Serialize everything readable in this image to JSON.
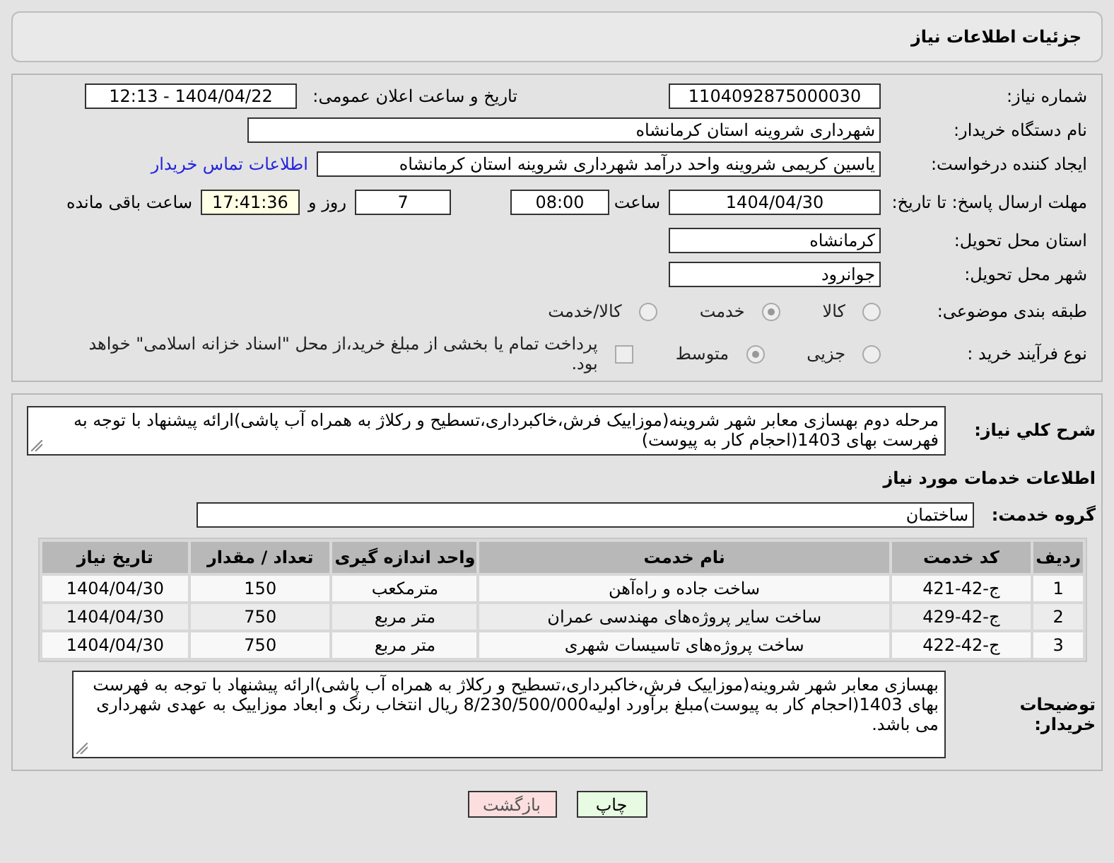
{
  "page_title": "جزئیات اطلاعات نیاز",
  "need_info": {
    "need_number": {
      "label": "شماره نیاز:",
      "value": "1104092875000030"
    },
    "announce_datetime": {
      "label": "تاریخ و ساعت اعلان عمومی:",
      "value": "1404/04/22 - 12:13"
    },
    "buyer_org": {
      "label": "نام دستگاه خریدار:",
      "value": "شهرداری شروینه استان کرمانشاه"
    },
    "requester": {
      "label": "ایجاد کننده درخواست:",
      "value": "یاسین کریمی شروینه واحد درآمد شهرداری شروینه استان کرمانشاه",
      "link": "اطلاعات تماس خریدار"
    },
    "deadline": {
      "label": "مهلت ارسال پاسخ: تا تاریخ:",
      "date": "1404/04/30",
      "time_label": "ساعت",
      "time": "08:00",
      "days": "7",
      "days_label": "روز و",
      "remaining": "17:41:36",
      "remaining_label": "ساعت باقی مانده"
    },
    "province": {
      "label": "استان محل تحویل:",
      "value": "کرمانشاه"
    },
    "city": {
      "label": "شهر محل تحویل:",
      "value": "جوانرود"
    },
    "category": {
      "label": "طبقه بندی موضوعی:",
      "options": [
        {
          "label": "کالا",
          "selected": false
        },
        {
          "label": "خدمت",
          "selected": true
        },
        {
          "label": "کالا/خدمت",
          "selected": false
        }
      ]
    },
    "process": {
      "label": "نوع فرآیند خرید :",
      "options": [
        {
          "label": "جزیی",
          "selected": false
        },
        {
          "label": "متوسط",
          "selected": true
        }
      ],
      "payment_note": {
        "label": "پرداخت تمام یا بخشی از مبلغ خرید،از محل \"اسناد خزانه اسلامی\" خواهد بود.",
        "checked": false
      }
    }
  },
  "services": {
    "summary": {
      "label": "شرح کلي نياز:",
      "value": "مرحله دوم بهسازی معابر شهر شروینه(موزاییک فرش،خاکبرداری،تسطیح و رکلاژ به همراه آب پاشی)ارائه پیشنهاد با توجه به فهرست بهای 1403(احجام کار به پیوست)"
    },
    "heading": "اطلاعات خدمات مورد نیاز",
    "service_group": {
      "label": "گروه خدمت:",
      "value": "ساختمان"
    },
    "table": {
      "columns": [
        "ردیف",
        "کد خدمت",
        "نام خدمت",
        "واحد اندازه گیری",
        "تعداد / مقدار",
        "تاریخ نیاز"
      ],
      "rows": [
        [
          "1",
          "ج-42-421",
          "ساخت جاده و راه‌آهن",
          "مترمکعب",
          "150",
          "1404/04/30"
        ],
        [
          "2",
          "ج-42-429",
          "ساخت سایر پروژه‌های مهندسی عمران",
          "متر مربع",
          "750",
          "1404/04/30"
        ],
        [
          "3",
          "ج-42-422",
          "ساخت پروژه‌های تاسیسات شهری",
          "متر مربع",
          "750",
          "1404/04/30"
        ]
      ]
    },
    "buyer_notes": {
      "label": "توضیحات خریدار:",
      "value": "بهسازی معابر شهر شروینه(موزاییک فرش،خاکبرداری،تسطیح و رکلاژ به همراه آب پاشی)ارائه پیشنهاد با توجه به فهرست بهای 1403(احجام کار به پیوست)مبلغ برآورد اولیه8/230/500/000 ریال انتخاب رنگ و ابعاد موزاییک به عهدی شهرداری می باشد."
    }
  },
  "buttons": [
    {
      "label": "چاپ",
      "kind": "print"
    },
    {
      "label": "بازگشت",
      "kind": "back"
    }
  ]
}
